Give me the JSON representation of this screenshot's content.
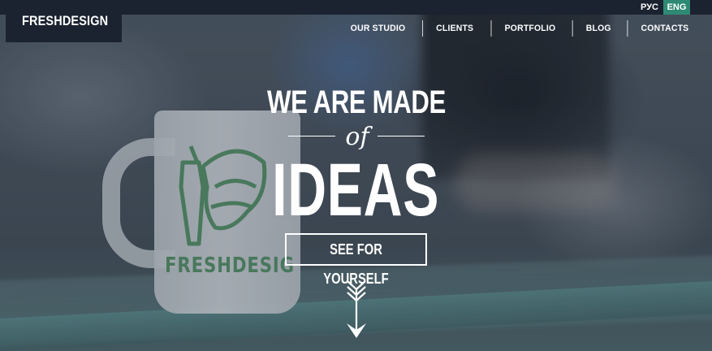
{
  "header": {
    "brand": "FRESHDESIGN",
    "languages": [
      {
        "label": "РУС",
        "active": false
      },
      {
        "label": "ENG",
        "active": true
      }
    ],
    "nav": [
      "OUR STUDIO",
      "CLIENTS",
      "PORTFOLIO",
      "BLOG",
      "CONTACTS"
    ]
  },
  "hero": {
    "line1": "WE ARE MADE",
    "connector": "of",
    "line2": "IDEAS",
    "cta": "SEE FOR YOURSELF"
  },
  "background": {
    "mug_text": "FRESHDESIG"
  },
  "colors": {
    "topbar": "#1b2230",
    "accent": "#2f8a74",
    "text": "#ffffff"
  },
  "icons": {
    "logo": "artichoke-logo-icon",
    "scroll": "down-arrow-icon"
  }
}
